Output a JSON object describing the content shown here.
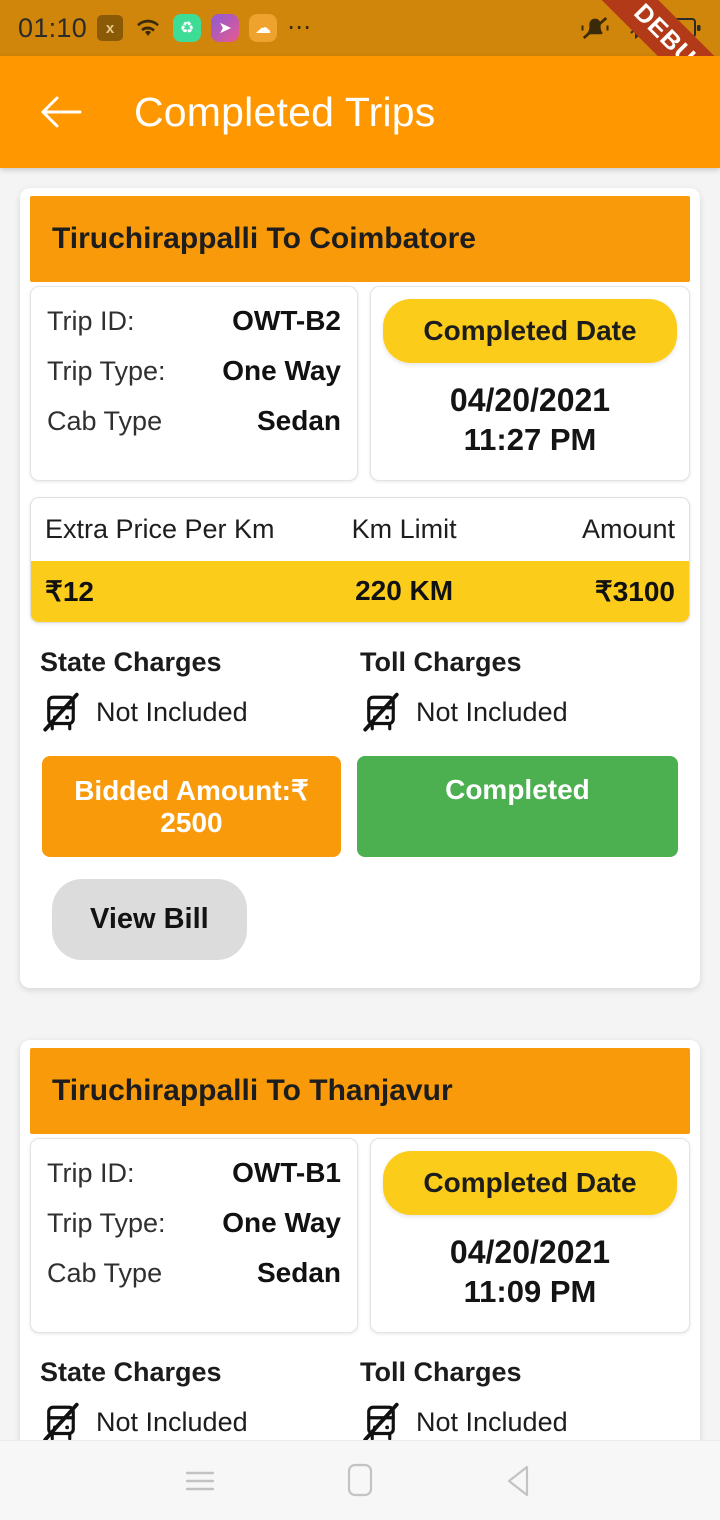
{
  "status_bar": {
    "time": "01:10",
    "icons": [
      "x-badge-icon",
      "wifi-icon",
      "app-green-icon",
      "app-purple-icon",
      "app-orange-icon",
      "overflow-dots-icon"
    ],
    "right_icons": [
      "mute-bell-icon",
      "bluetooth-icon",
      "battery-icon"
    ],
    "debug_ribbon": "DEBUG"
  },
  "app_bar": {
    "back_label": "back-arrow",
    "title": "Completed Trips"
  },
  "labels": {
    "trip_id": "Trip ID:",
    "trip_type": "Trip Type:",
    "cab_type": "Cab Type",
    "completed_date": "Completed Date",
    "extra_price_per_km": "Extra Price Per Km",
    "km_limit": "Km Limit",
    "amount": "Amount",
    "state_charges": "State Charges",
    "toll_charges": "Toll Charges",
    "view_bill": "View Bill"
  },
  "colors": {
    "appbar_orange": "#FF9800",
    "card_header_orange": "#F99A0B",
    "yellow": "#FCCC1A",
    "green": "#4CAF50",
    "grey_button": "#DCDCDC",
    "page_background": "#F4F4F4"
  },
  "trips": [
    {
      "route": "Tiruchirappalli To Coimbatore",
      "trip_id": "OWT-B2",
      "trip_type": "One Way",
      "cab_type": "Sedan",
      "completed_date": "04/20/2021",
      "completed_time": "11:27 PM",
      "extra_price_per_km": "₹12",
      "km_limit": "220 KM",
      "amount": "₹3100",
      "state_charges_value": "Not Included",
      "toll_charges_value": "Not Included",
      "bidded_amount": "Bidded Amount:₹ 2500",
      "status": "Completed",
      "view_bill": "View Bill"
    },
    {
      "route": "Tiruchirappalli To Thanjavur",
      "trip_id": "OWT-B1",
      "trip_type": "One Way",
      "cab_type": "Sedan",
      "completed_date": "04/20/2021",
      "completed_time": "11:09 PM",
      "state_charges_value": "Not Included",
      "toll_charges_value": "Not Included"
    }
  ],
  "nav_bar": {
    "recents": "recents-icon",
    "home": "home-icon",
    "back": "back-icon"
  }
}
